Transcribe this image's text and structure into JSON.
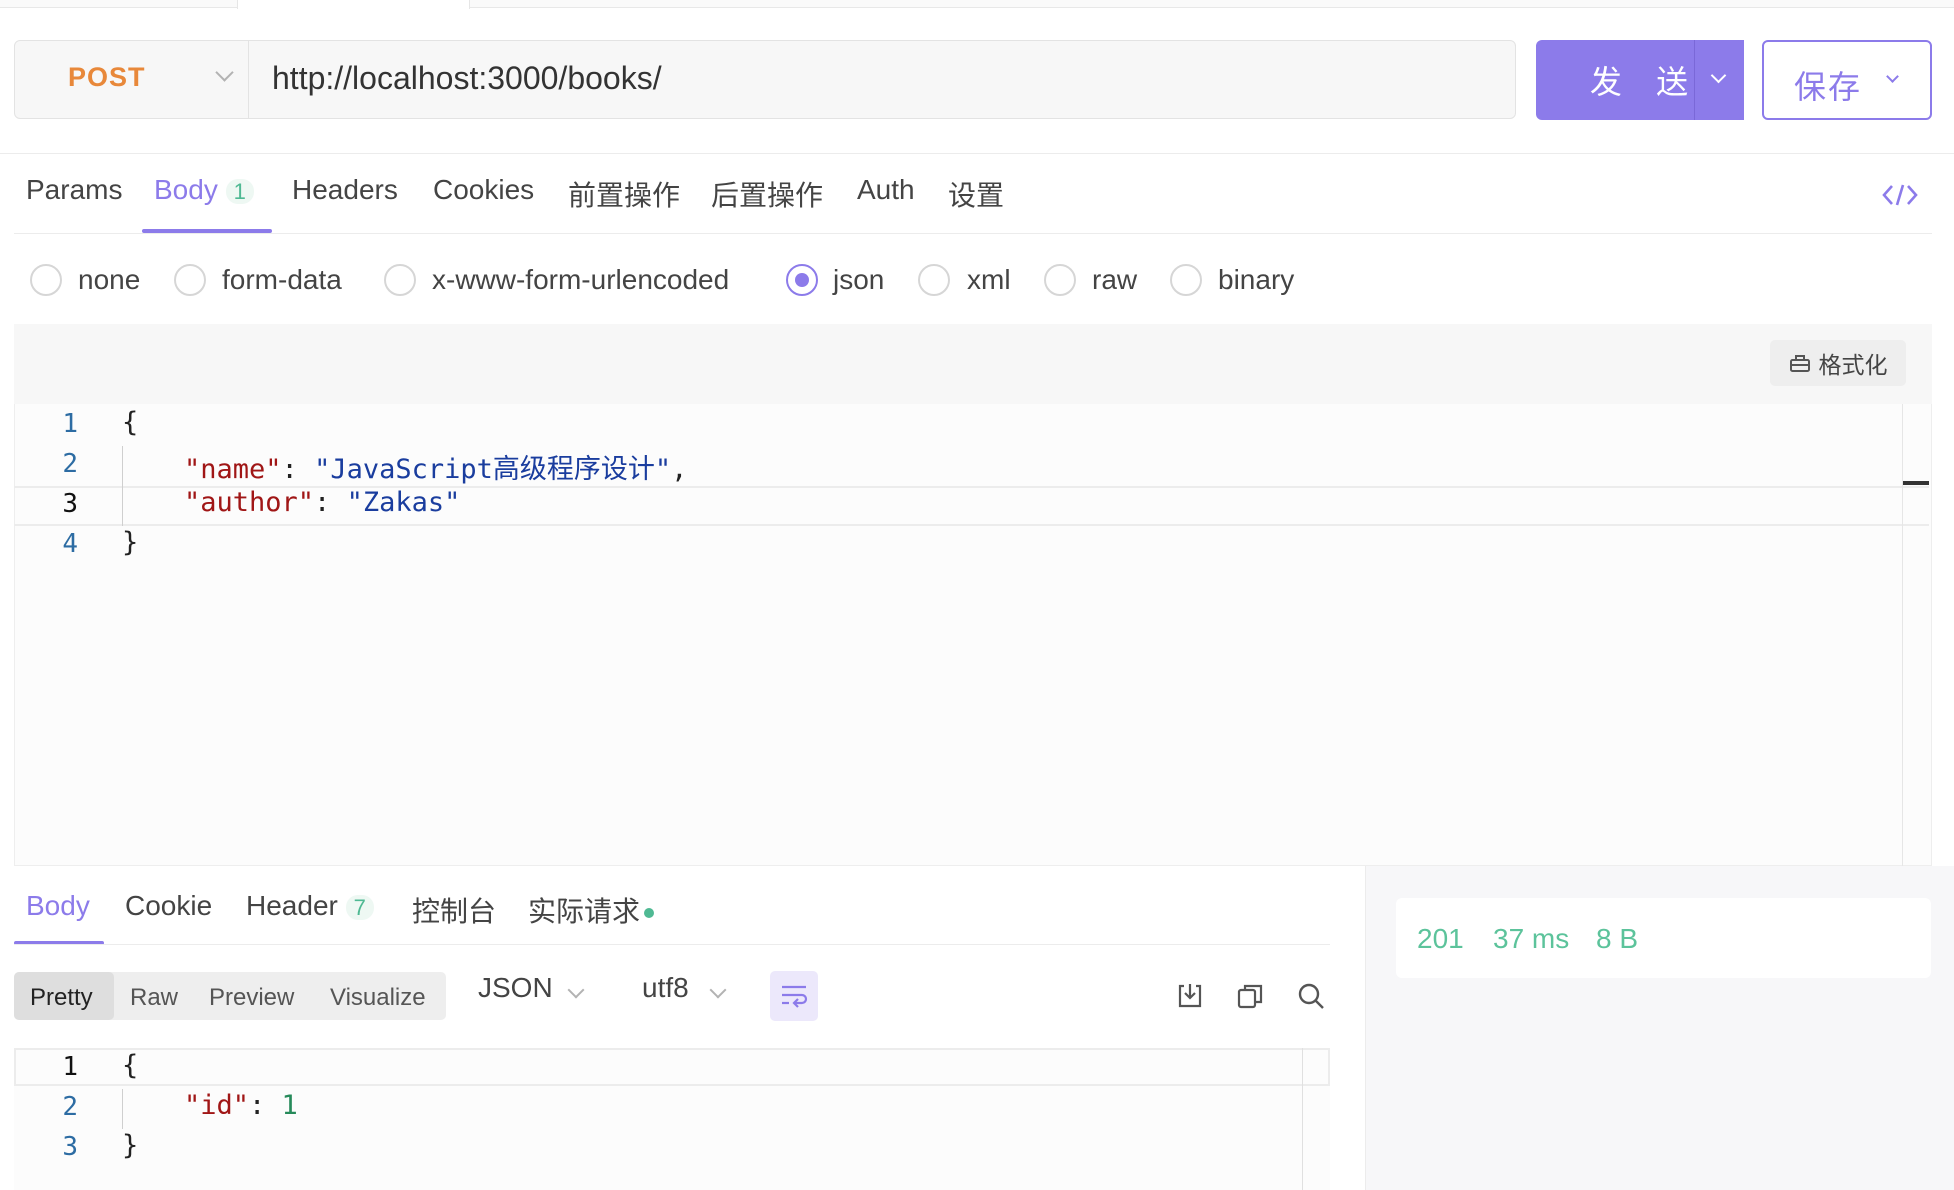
{
  "request": {
    "method": "POST",
    "url": "http://localhost:3000/books/",
    "send_label": "发 送",
    "save_label": "保存"
  },
  "request_tabs": [
    {
      "label": "Params"
    },
    {
      "label": "Body",
      "badge": "1"
    },
    {
      "label": "Headers"
    },
    {
      "label": "Cookies"
    },
    {
      "label": "前置操作"
    },
    {
      "label": "后置操作"
    },
    {
      "label": "Auth"
    },
    {
      "label": "设置"
    }
  ],
  "body_types": [
    "none",
    "form-data",
    "x-www-form-urlencoded",
    "json",
    "xml",
    "raw",
    "binary"
  ],
  "body_type_selected": "json",
  "editor": {
    "format_label": "格式化",
    "line_numbers": [
      "1",
      "2",
      "3",
      "4"
    ],
    "lines": {
      "l1": "{",
      "l2_key": "\"name\"",
      "l2_colon": ": ",
      "l2_val": "\"JavaScript高级程序设计\"",
      "l2_tail": ",",
      "l3_key": "\"author\"",
      "l3_colon": ": ",
      "l3_val": "\"Zakas\"",
      "l4": "}"
    }
  },
  "response": {
    "tabs": [
      {
        "label": "Body"
      },
      {
        "label": "Cookie"
      },
      {
        "label": "Header",
        "badge": "7"
      },
      {
        "label": "控制台"
      },
      {
        "label": "实际请求"
      }
    ],
    "view_modes": [
      "Pretty",
      "Raw",
      "Preview",
      "Visualize"
    ],
    "view_mode_selected": "Pretty",
    "format": "JSON",
    "encoding": "utf8",
    "line_numbers": [
      "1",
      "2",
      "3"
    ],
    "lines": {
      "l1": "{",
      "l2_key": "\"id\"",
      "l2_colon": ": ",
      "l2_val": "1",
      "l3": "}"
    },
    "status": {
      "code": "201",
      "time": "37 ms",
      "size": "8 B"
    }
  },
  "colors": {
    "accent": "#8c7bea",
    "method": "#e8883a",
    "success": "#4fb993"
  }
}
